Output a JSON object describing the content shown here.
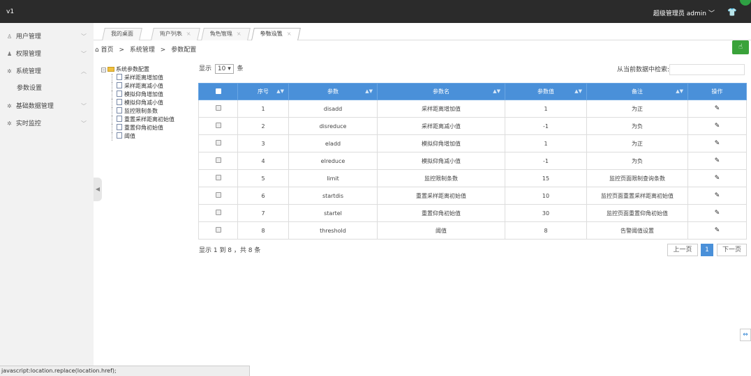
{
  "topbar": {
    "brand": "v1",
    "user": "超级管理员 admin",
    "user_chevron": "chevron-down-icon",
    "shirt_icon": "shirt-icon"
  },
  "sidebar": {
    "items": [
      {
        "label": "用户管理",
        "icon": "user-outline-icon",
        "glyph": "♙",
        "chevron": "﹀"
      },
      {
        "label": "权限管理",
        "icon": "user-icon",
        "glyph": "♟",
        "chevron": "﹀"
      },
      {
        "label": "系统管理",
        "icon": "gear-icon",
        "glyph": "✲",
        "chevron": "︿"
      },
      {
        "label": "基础数据管理",
        "icon": "gear-icon",
        "glyph": "✲",
        "chevron": "﹀"
      },
      {
        "label": "实时监控",
        "icon": "gear-icon",
        "glyph": "✲",
        "chevron": "﹀"
      }
    ],
    "sub_item": "参数设置"
  },
  "tabs": [
    {
      "label": "我的桌面",
      "closable": false
    },
    {
      "label": "用户列表",
      "closable": true
    },
    {
      "label": "角色管理",
      "closable": true
    },
    {
      "label": "参数设置",
      "closable": true,
      "active": true
    }
  ],
  "breadcrumb": {
    "home": "首页",
    "sep": ">",
    "level1": "系统管理",
    "level2": "参数配置"
  },
  "tree": {
    "root": "系统参数配置",
    "children": [
      "采样距离增加值",
      "采样距离减小值",
      "模拟仰角增加值",
      "模拟仰角减小值",
      "监控限制条数",
      "重置采样距离初始值",
      "重置仰角初始值",
      "阈值"
    ]
  },
  "table_controls": {
    "show_prefix": "显示",
    "page_length": "10",
    "show_suffix": "条",
    "search_label": "从当前数据中检索:",
    "search_value": ""
  },
  "table": {
    "headers": [
      "序号",
      "参数",
      "参数名",
      "参数值",
      "备注",
      "操作"
    ],
    "rows": [
      [
        "1",
        "disadd",
        "采样距离增加值",
        "1",
        "为正"
      ],
      [
        "2",
        "disreduce",
        "采样距离减小值",
        "-1",
        "为负"
      ],
      [
        "3",
        "eladd",
        "模拟仰角增加值",
        "1",
        "为正"
      ],
      [
        "4",
        "elreduce",
        "模拟仰角减小值",
        "-1",
        "为负"
      ],
      [
        "5",
        "limit",
        "监控限制条数",
        "15",
        "监控页面限制查询条数"
      ],
      [
        "6",
        "startdis",
        "重置采样距离初始值",
        "10",
        "监控页面重置采样距离初始值"
      ],
      [
        "7",
        "startel",
        "重置仰角初始值",
        "30",
        "监控页面重置仰角初始值"
      ],
      [
        "8",
        "threshold",
        "阈值",
        "8",
        "告警阈值设置"
      ]
    ]
  },
  "footer": {
    "info": "显示 1 到 8 ，共 8 条",
    "prev": "上一页",
    "page": "1",
    "next": "下一页"
  },
  "statusbar": "javascript:location.replace(location.href);"
}
